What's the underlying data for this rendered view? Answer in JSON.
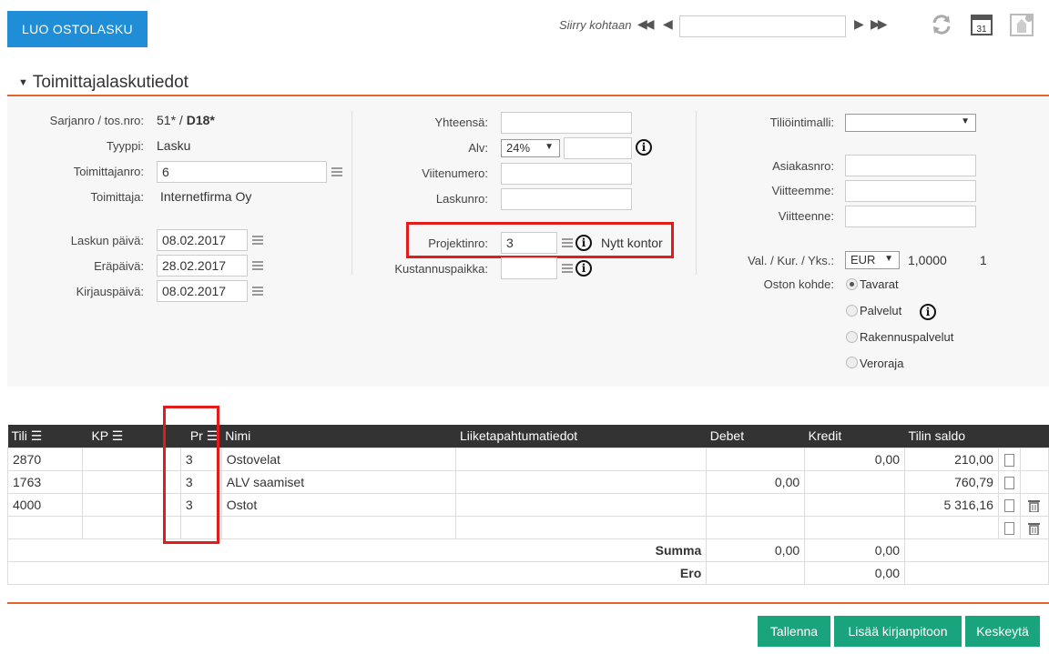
{
  "toolbar": {
    "create_button": "LUO OSTOLASKU",
    "goto_label": "Siirry kohtaan",
    "goto_value": "",
    "calendar_day": "31"
  },
  "section": {
    "title": "Toimittajalaskutiedot"
  },
  "col1": {
    "serial_label": "Sarjanro / tos.nro:",
    "serial_value": "51* /",
    "serial_doc": "D18*",
    "type_label": "Tyyppi:",
    "type_value": "Lasku",
    "supplier_no_label": "Toimittajanro:",
    "supplier_no_value": "6",
    "supplier_label": "Toimittaja:",
    "supplier_value": "Internetfirma Oy",
    "invoice_date_label": "Laskun päivä:",
    "invoice_date_value": "08.02.2017",
    "due_date_label": "Eräpäivä:",
    "due_date_value": "28.02.2017",
    "booking_date_label": "Kirjauspäivä:",
    "booking_date_value": "08.02.2017"
  },
  "col2": {
    "total_label": "Yhteensä:",
    "total_value": "",
    "vat_label": "Alv:",
    "vat_select": "24%",
    "vat_amount": "",
    "ref_label": "Viitenumero:",
    "ref_value": "",
    "invoice_no_label": "Laskunro:",
    "invoice_no_value": "",
    "project_label": "Projektinro:",
    "project_value": "3",
    "project_name": "Nytt kontor",
    "cost_center_label": "Kustannuspaikka:",
    "cost_center_value": ""
  },
  "col3": {
    "template_label": "Tiliöintimalli:",
    "template_value": "",
    "customer_no_label": "Asiakasnro:",
    "customer_no_value": "",
    "our_ref_label": "Viitteemme:",
    "our_ref_value": "",
    "your_ref_label": "Viitteenne:",
    "your_ref_value": "",
    "currency_label": "Val. / Kur. / Yks.:",
    "currency": "EUR",
    "rate": "1,0000",
    "unit": "1",
    "purchase_target_label": "Oston kohde:",
    "options": [
      "Tavarat",
      "Palvelut",
      "Rakennuspalvelut",
      "Veroraja"
    ],
    "selected": "Tavarat"
  },
  "grid": {
    "headers": {
      "account": "Tili",
      "kp": "KP",
      "pr": "Pr",
      "name": "Nimi",
      "details": "Liiketapahtumatiedot",
      "debit": "Debet",
      "credit": "Kredit",
      "balance": "Tilin saldo"
    },
    "rows": [
      {
        "account": "2870",
        "kp": "",
        "pr": "3",
        "name": "Ostovelat",
        "details": "",
        "debit": "",
        "credit": "0,00",
        "balance": "210,00"
      },
      {
        "account": "1763",
        "kp": "",
        "pr": "3",
        "name": "ALV saamiset",
        "details": "",
        "debit": "0,00",
        "credit": "",
        "balance": "760,79"
      },
      {
        "account": "4000",
        "kp": "",
        "pr": "3",
        "name": "Ostot",
        "details": "",
        "debit": "",
        "credit": "",
        "balance": "5 316,16"
      },
      {
        "account": "",
        "kp": "",
        "pr": "",
        "name": "",
        "details": "",
        "debit": "",
        "credit": "",
        "balance": ""
      }
    ],
    "sum_label": "Summa",
    "sum_debit": "0,00",
    "sum_credit": "0,00",
    "diff_label": "Ero",
    "diff_value": "0,00"
  },
  "footer": {
    "save": "Tallenna",
    "add_to_ledger": "Lisää kirjanpitoon",
    "cancel": "Keskeytä"
  },
  "colors": {
    "primary": "#1f8ed6",
    "accent": "#e8632a",
    "green": "#19a47d",
    "highlight": "#e31b1b"
  }
}
